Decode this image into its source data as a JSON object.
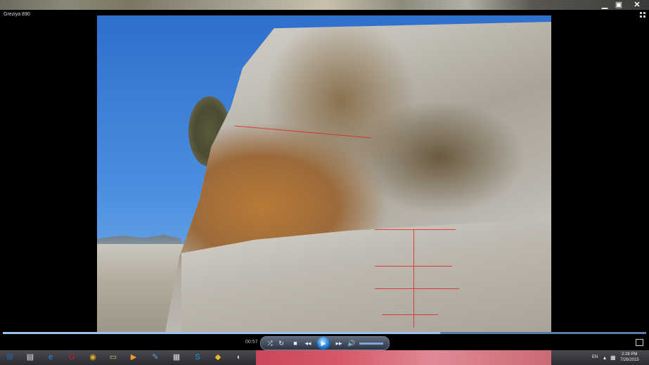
{
  "window": {
    "title": "Greziya 890",
    "controls": {
      "minimize_icon": "minimize-icon",
      "maximize_icon": "maximize-icon",
      "close_icon": "close-icon"
    }
  },
  "player": {
    "timecode": "00:57",
    "seek_progress": 0.68,
    "buttons": {
      "shuffle": "⤮",
      "repeat": "↻",
      "stop": "■",
      "previous": "◂◂",
      "play": "▶",
      "next": "▸▸",
      "volume": "🔊"
    }
  },
  "taskbar": {
    "items": [
      {
        "name": "start-button",
        "glyph": "⊞",
        "color": "#1e6fb8"
      },
      {
        "name": "taskbar-file",
        "glyph": "▤",
        "color": "#e8e8e8"
      },
      {
        "name": "taskbar-ie",
        "glyph": "e",
        "color": "#2d8be0"
      },
      {
        "name": "taskbar-opera",
        "glyph": "O",
        "color": "#cc1f1f"
      },
      {
        "name": "taskbar-chrome",
        "glyph": "◉",
        "color": "#e1b21f"
      },
      {
        "name": "taskbar-explorer",
        "glyph": "▭",
        "color": "#e6c34a"
      },
      {
        "name": "taskbar-media",
        "glyph": "▶",
        "color": "#f29c2b"
      },
      {
        "name": "taskbar-paint",
        "glyph": "✎",
        "color": "#6aa2d8"
      },
      {
        "name": "taskbar-calc",
        "glyph": "▦",
        "color": "#d8d8d8"
      },
      {
        "name": "taskbar-skype",
        "glyph": "S",
        "color": "#1ea0e0"
      },
      {
        "name": "taskbar-shield",
        "glyph": "◆",
        "color": "#f0c020"
      },
      {
        "name": "taskbar-disk",
        "glyph": "◐",
        "color": "#c0c0c0"
      }
    ],
    "tray": {
      "language": "EN",
      "time": "2:28 PM",
      "date": "7/26/2015"
    }
  }
}
